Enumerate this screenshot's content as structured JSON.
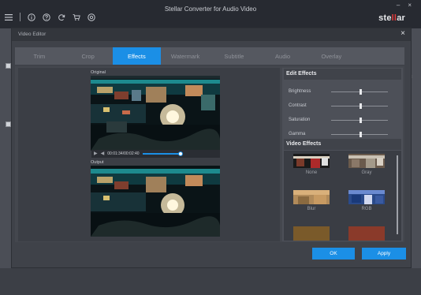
{
  "app": {
    "title": "Stellar Converter for Audio Video",
    "logo_pre": "ste",
    "logo_mid": "ll",
    "logo_post": "ar",
    "minimize_glyph": "–",
    "close_glyph": "×"
  },
  "toolbar": {
    "icons": [
      "menu-icon",
      "info-icon",
      "help-icon",
      "refresh-icon",
      "cart-icon",
      "settings-icon"
    ]
  },
  "editor": {
    "title": "Video Editor",
    "close_glyph": "×",
    "tabs": [
      {
        "label": "Trim"
      },
      {
        "label": "Crop"
      },
      {
        "label": "Effects",
        "active": true
      },
      {
        "label": "Watermark"
      },
      {
        "label": "Subtitle"
      },
      {
        "label": "Audio"
      },
      {
        "label": "Overlay"
      }
    ],
    "original_label": "Original",
    "output_label": "Output",
    "player": {
      "timecode": "00:01:34/00:02:40",
      "progress": 0.59
    },
    "edit_effects": {
      "title": "Edit Effects",
      "sliders": [
        {
          "label": "Brightness",
          "value": 0.52
        },
        {
          "label": "Contrast",
          "value": 0.51
        },
        {
          "label": "Saturation",
          "value": 0.51
        },
        {
          "label": "Gamma",
          "value": 0.51
        }
      ]
    },
    "video_effects": {
      "title": "Video Effects",
      "items": [
        {
          "label": "None"
        },
        {
          "label": "Gray"
        },
        {
          "label": "Blur"
        },
        {
          "label": "RGB"
        }
      ]
    },
    "ok_label": "OK",
    "apply_label": "Apply"
  },
  "colors": {
    "accent": "#1b8fe6",
    "logo_red": "#e23b3b",
    "window_bg": "#3f4249"
  }
}
